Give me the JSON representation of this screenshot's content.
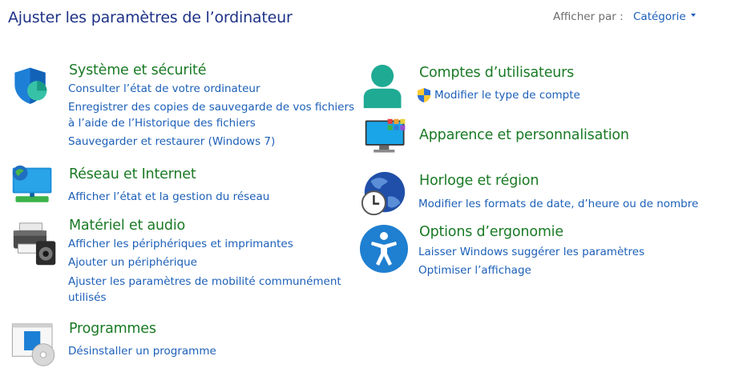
{
  "page_title": "Ajuster les paramètres de l’ordinateur",
  "view_by": {
    "label": "Afficher par :",
    "value": "Catégorie"
  },
  "categories": {
    "system": {
      "heading": "Système et sécurité",
      "links": [
        "Consulter l’état de votre ordinateur",
        "Enregistrer des copies de sauvegarde de vos fichiers",
        "à l’aide de l’Historique des fichiers",
        "Sauvegarder et restaurer (Windows 7)"
      ]
    },
    "network": {
      "heading": "Réseau et Internet",
      "links": [
        "Afficher l’état et la gestion du réseau"
      ]
    },
    "hardware": {
      "heading": "Matériel et audio",
      "links": [
        "Afficher les périphériques et imprimantes",
        "Ajouter un périphérique",
        "Ajuster les paramètres de mobilité communément",
        "utilisés"
      ]
    },
    "programs": {
      "heading": "Programmes",
      "links": [
        "Désinstaller un programme"
      ]
    },
    "accounts": {
      "heading": "Comptes d’utilisateurs",
      "links": [
        "Modifier le type de compte"
      ]
    },
    "appearance": {
      "heading": "Apparence et personnalisation",
      "links": []
    },
    "clock": {
      "heading": "Horloge et région",
      "links": [
        "Modifier les formats de date, d’heure ou de nombre"
      ]
    },
    "ease": {
      "heading": "Options d’ergonomie",
      "links": [
        "Laisser Windows suggérer les paramètres",
        "Optimiser l’affichage"
      ]
    }
  },
  "colors": {
    "title": "#1e3287",
    "heading": "#1a7a25",
    "link": "#1c5fb8",
    "muted": "#6d6d6d"
  },
  "icons": {
    "system": "shield-icon",
    "network": "network-globe-icon",
    "hardware": "printer-speaker-icon",
    "programs": "programs-disc-icon",
    "accounts": "user-icon",
    "appearance": "monitor-palette-icon",
    "clock": "globe-clock-icon",
    "ease": "accessibility-icon"
  }
}
